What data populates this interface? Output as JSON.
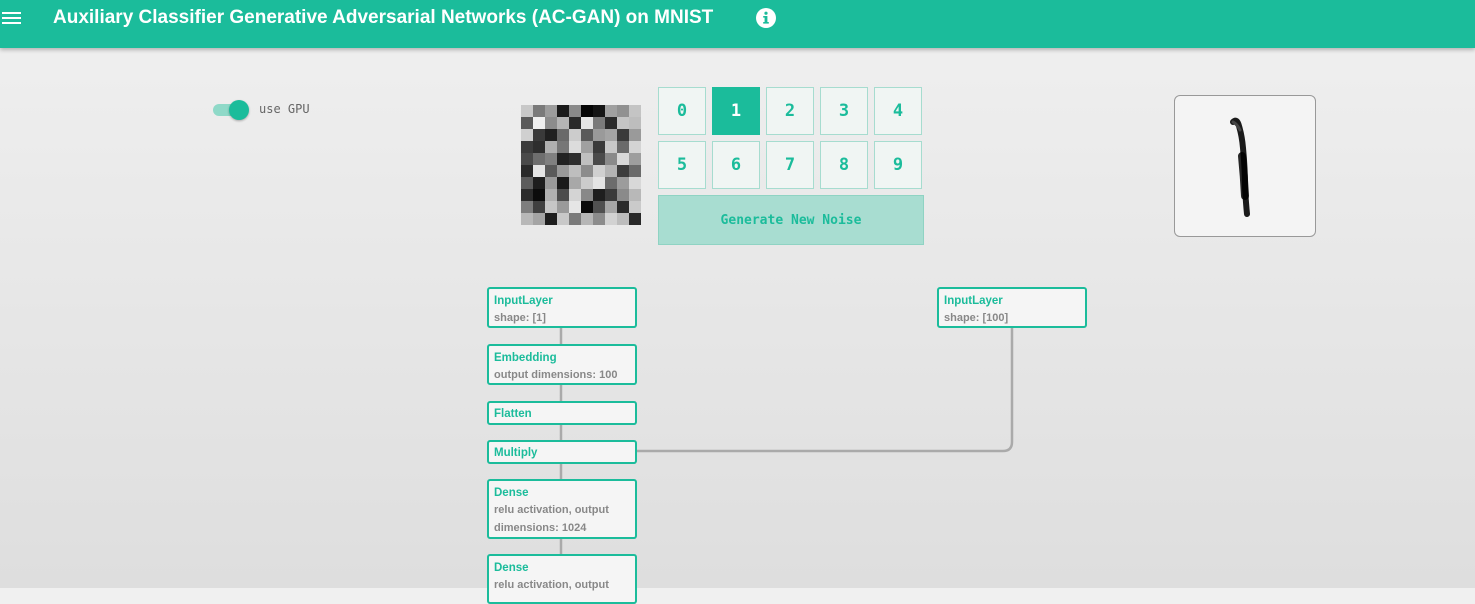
{
  "header": {
    "title": "Auxiliary Classifier Generative Adversarial Networks (AC-GAN) on MNIST",
    "menu_icon": "hamburger-menu-icon",
    "info_icon": "info-circle-icon"
  },
  "controls": {
    "gpu_label": "use GPU",
    "gpu_enabled": true,
    "digits": [
      "0",
      "1",
      "2",
      "3",
      "4",
      "5",
      "6",
      "7",
      "8",
      "9"
    ],
    "selected_digit": "1",
    "generate_label": "Generate New Noise"
  },
  "colors": {
    "accent": "#1bbc9b",
    "accent_light": "#a8ddd1",
    "noise_grays": [
      "#c8c8c8",
      "#7a7a7a",
      "#9c9c9c",
      "#1a1a1a",
      "#8a8a8a",
      "#050505",
      "#141414",
      "#a0a0a0",
      "#909090",
      "#c4c4c4",
      "#5a5a5a",
      "#f0f0f0",
      "#8c8c8c",
      "#b4b4b4",
      "#2a2a2a",
      "#e6e6e6",
      "#7a7a7a",
      "#2a2a2a",
      "#c4c4c4",
      "#bdbdbd",
      "#d0d0d0",
      "#3a3a3a",
      "#202020",
      "#6a6a6a",
      "#cccccc",
      "#5a5a5a",
      "#9a9a9a",
      "#a4a4a4",
      "#3a3a3a",
      "#9a9a9a",
      "#3c3c3c",
      "#2e2e2e",
      "#b0b0b0",
      "#777777",
      "#dcdcdc",
      "#a0a0a0",
      "#3a3a3a",
      "#c8c8c8",
      "#6a6a6a",
      "#d4d4d4",
      "#4a4a4a",
      "#6e6e6e",
      "#808080",
      "#222222",
      "#2e2e2e",
      "#c0c0c0",
      "#4a4a4a",
      "#8a8a8a",
      "#d8d8d8",
      "#9e9e9e",
      "#2a2a2a",
      "#e4e4e4",
      "#5a5a5a",
      "#999999",
      "#bebebe",
      "#8c8c8c",
      "#d0d0d0",
      "#b4b4b4",
      "#3c3c3c",
      "#6a6a6a",
      "#5c5c5c",
      "#1e1e1e",
      "#9a9a9a",
      "#1a1a1a",
      "#a8a8a8",
      "#cccccc",
      "#e4e4e4",
      "#6c6c6c",
      "#9c9c9c",
      "#d8d8d8",
      "#2c2c2c",
      "#0c0c0c",
      "#b0b0b0",
      "#4c4c4c",
      "#d4d4d4",
      "#888888",
      "#1e1e1e",
      "#3a3a3a",
      "#8a8a8a",
      "#b8b8b8",
      "#7e7e7e",
      "#404040",
      "#c6c6c6",
      "#9a9a9a",
      "#e6e6e6",
      "#0a0a0a",
      "#505050",
      "#a6a6a6",
      "#2a2a2a",
      "#cacaca",
      "#b8b8b8",
      "#a4a4a4",
      "#1e1e1e",
      "#c8c8c8",
      "#7a7a7a",
      "#b6b6b6",
      "#8c8c8c",
      "#d2d2d2",
      "#bcbcbc",
      "#282828"
    ]
  },
  "network": {
    "left_column": [
      {
        "name": "InputLayer",
        "desc": "shape: [1]"
      },
      {
        "name": "Embedding",
        "desc": "output dimensions: 100"
      },
      {
        "name": "Flatten",
        "desc": ""
      },
      {
        "name": "Multiply",
        "desc": ""
      },
      {
        "name": "Dense",
        "desc": "relu activation, output dimensions: 1024"
      },
      {
        "name": "Dense",
        "desc": "relu activation, output"
      }
    ],
    "right_column": [
      {
        "name": "InputLayer",
        "desc": "shape: [100]"
      }
    ]
  }
}
